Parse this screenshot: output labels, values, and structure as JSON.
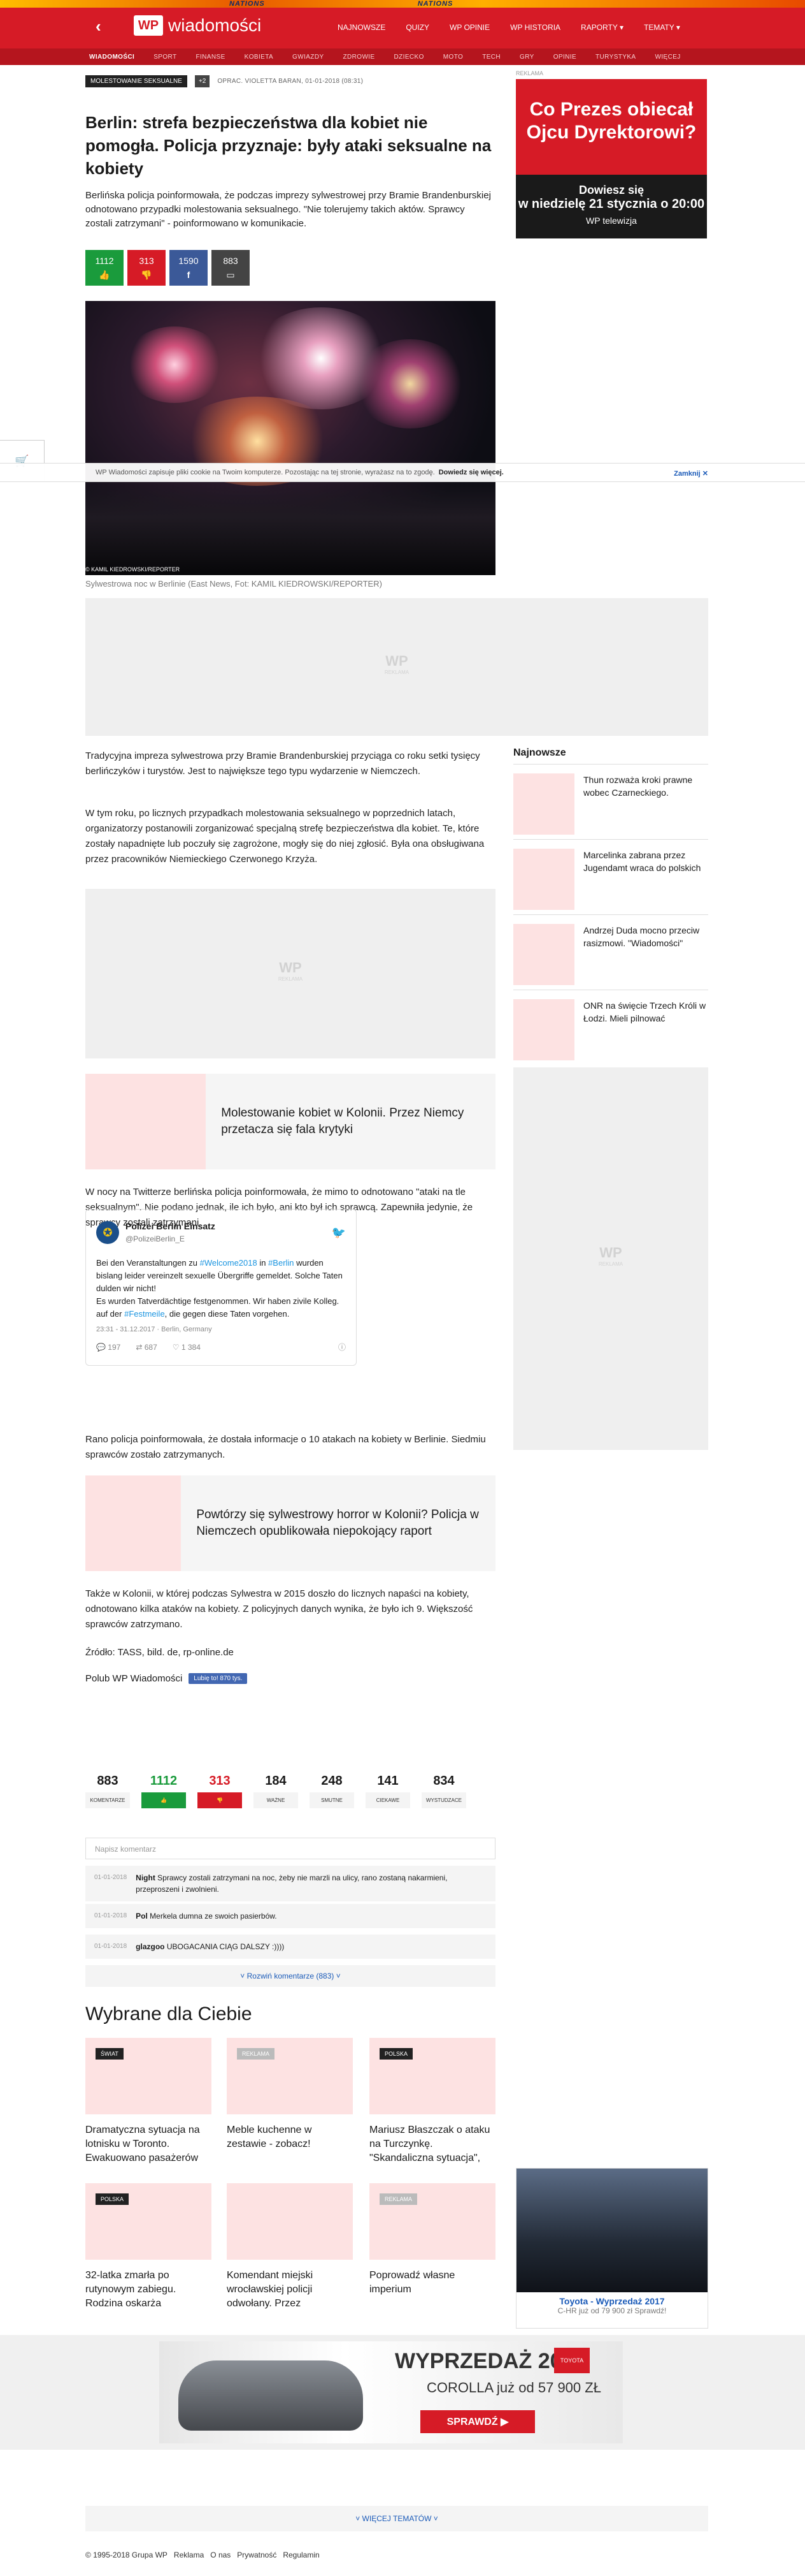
{
  "header": {
    "banner": [
      "NATIONS",
      "NATIONS"
    ],
    "logo_mark": "WP",
    "logo_name": "wiadomości",
    "nav": [
      "NAJNOWSZE",
      "QUIZY",
      "WP OPINIE",
      "WP HISTORIA",
      "RAPORTY ▾",
      "TEMATY ▾"
    ],
    "subnav": [
      "WIADOMOŚCI",
      "SPORT",
      "FINANSE",
      "KOBIETA",
      "GWIAZDY",
      "ZDROWIE",
      "DZIECKO",
      "MOTO",
      "TECH",
      "GRY",
      "OPINIE",
      "TURYSTYKA",
      "więcej"
    ]
  },
  "article": {
    "tag": "MOLESTOWANIE SEKSUALNE",
    "tag_more": "+2",
    "byline": "OPRAC. VIOLETTA BARAN, 01-01-2018 (08:31)",
    "title": "Berlin: strefa bezpieczeństwa dla kobiet nie pomogła. Policja przyznaje: były ataki seksualne na kobiety",
    "lead": "Berlińska policja poinformowała, że podczas imprezy sylwestrowej przy Bramie Brandenburskiej odnotowano przypadki molestowania seksualnego. \"Nie tolerujemy takich aktów. Sprawcy zostali zatrzymani\" - poinformowano w komunikacie.",
    "buttons": {
      "likes": "1112",
      "dislikes": "313",
      "fb": "1590",
      "comments": "883"
    },
    "photo_credit": "© KAMIL KIEDROWSKI/REPORTER",
    "caption": "Sylwestrowa noc w Berlinie (East News, Fot: KAMIL KIEDROWSKI/REPORTER)",
    "p1": "Tradycyjna impreza sylwestrowa przy Bramie Brandenburskiej przyciąga co roku setki tysięcy berlińczyków i turystów. Jest to największe tego typu wydarzenie w Niemczech.",
    "p2": "W tym roku, po licznych przypadkach molestowania seksualnego w poprzednich latach, organizatorzy postanowili zorganizować specjalną strefę bezpieczeństwa dla kobiet. Te, które zostały napadnięte lub poczuły się zagrożone, mogły się do niej zgłosić. Była ona obsługiwana przez pracowników Niemieckiego Czerwonego Krzyża.",
    "related1": "Molestowanie kobiet w Kolonii. Przez Niemcy przetacza się fala krytyki",
    "p3": "W nocy na Twitterze berlińska policja poinformowała, że mimo to odnotowano \"ataki na tle seksualnym\". Nie podano jednak, ile ich było, ani kto był ich sprawcą. Zapewniła jedynie, że sprawcy zostali zatrzymani.",
    "p4": "Rano policja poinformowała, że dostała informacje o 10 atakach na kobiety w Berlinie. Siedmiu sprawców zostało zatrzymanych.",
    "related2": "Powtórzy się sylwestrowy horror w Kolonii? Policja w Niemczech opublikowała niepokojący raport",
    "p5": "Także w Kolonii, w której podczas Sylwestra w 2015 doszło do licznych napaści na kobiety, odnotowano kilka ataków na kobiety. Z policyjnych danych wynika, że było ich 9. Większość sprawców zatrzymano.",
    "source": "Źródło: TASS, bild. de, rp-online.de",
    "like_wp": "Polub WP Wiadomości",
    "fb_like": "Lubię to! 870 tys."
  },
  "tweet": {
    "name": "Polizei Berlin Einsatz",
    "handle": "@PolizeiBerlin_E",
    "line1a": "Bei den Veranstaltungen zu ",
    "tag1": "#Welcome2018",
    "line1b": " in ",
    "tag2": "#Berlin",
    "line1c": " wurden bislang leider vereinzelt sexuelle Übergriffe gemeldet. Solche Taten dulden wir nicht!",
    "line2": "Es wurden Tatverdächtige festgenommen. Wir haben zivile Kolleg. auf der ",
    "tag3": "#Festmeile",
    "line2b": ", die gegen diese Taten vorgehen.",
    "meta": "23:31 - 31.12.2017 · Berlin, Germany",
    "replies": "197",
    "retweets": "687",
    "likes": "1 384"
  },
  "cookie": {
    "text": "WP Wiadomości zapisuje pliki cookie na Twoim komputerze. Pozostając na tej stronie, wyrażasz na to zgodę.",
    "link": "Dowiedz się więcej.",
    "close": "Zamknij ✕"
  },
  "sidebar": {
    "ad_label": "REKLAMA",
    "ad_title": "Co Prezes obiecał Ojcu Dyrektorowi?",
    "ad_line1": "Dowiesz się",
    "ad_line2": "w niedzielę 21 stycznia o 20:00",
    "ad_line3": "WP telewizja",
    "newest_title": "Najnowsze",
    "newest": [
      "Thun rozważa kroki prawne wobec Czarneckiego.",
      "Marcelinka zabrana przez Jugendamt wraca do polskich",
      "Andrzej Duda mocno przeciw rasizmowi. \"Wiadomości\"",
      "ONR na święcie Trzech Króli w Łodzi. Mieli pilnować"
    ]
  },
  "comments": {
    "stats": [
      {
        "n": "883",
        "l": "KOMENTARZE"
      },
      {
        "n": "1112",
        "l": "👍"
      },
      {
        "n": "313",
        "l": "👎"
      },
      {
        "n": "184",
        "l": "WAŻNE"
      },
      {
        "n": "248",
        "l": "SMUTNE"
      },
      {
        "n": "141",
        "l": "CIEKAWE"
      },
      {
        "n": "834",
        "l": "WYSTUDZACE"
      }
    ],
    "placeholder": "Napisz komentarz",
    "items": [
      {
        "date": "01-01-2018",
        "user": "Night",
        "text": "Sprawcy zostali zatrzymani na noc, żeby nie marzli na ulicy, rano zostaną nakarmieni, przeproszeni i zwolnieni."
      },
      {
        "date": "01-01-2018",
        "user": "Pol",
        "text": "Merkela dumna ze swoich pasierbów."
      },
      {
        "date": "01-01-2018",
        "user": "glazgoo",
        "text": "UBOGACANIA CIĄG DALSZY :))))"
      }
    ],
    "more": "˅ Rozwiń komentarze (883) ˅"
  },
  "picks": {
    "title": "Wybrane dla Ciebie",
    "cards": [
      {
        "label": "ŚWIAT",
        "title": "Dramatyczna sytuacja na lotnisku w Toronto. Ewakuowano pasażerów"
      },
      {
        "label": "REKLAMA",
        "title": "Meble kuchenne w zestawie - zobacz!"
      },
      {
        "label": "POLSKA",
        "title": "Mariusz Błaszczak o ataku na Turczynkę. \"Skandaliczna sytuacja\","
      },
      {
        "label": "POLSKA",
        "title": "32-latka zmarła po rutynowym zabiegu. Rodzina oskarża"
      },
      {
        "label": "",
        "title": "Komendant miejski wrocławskiej policji odwołany. Przez"
      },
      {
        "label": "REKLAMA",
        "title": "Poprowadź własne imperium"
      }
    ],
    "toyota_title": "Toyota - Wyprzedaż 2017",
    "toyota_sub": "C-HR już od 79 900 zł Sprawdź!"
  },
  "bottom_ad": {
    "title": "WYPRZEDAŻ 2017",
    "model": "COROLLA już od 57 900 ZŁ",
    "button": "SPRAWDŹ ▶",
    "logo": "TOYOTA"
  },
  "more_topics": "˅ WIĘCEJ TEMATÓW ˅",
  "footer": [
    "© 1995-2018 Grupa WP",
    "Reklama",
    "O nas",
    "Prywatność",
    "Regulamin"
  ],
  "colors": {
    "brand": "#d61b26",
    "like": "#1a9b3c",
    "facebook": "#3b5998"
  }
}
